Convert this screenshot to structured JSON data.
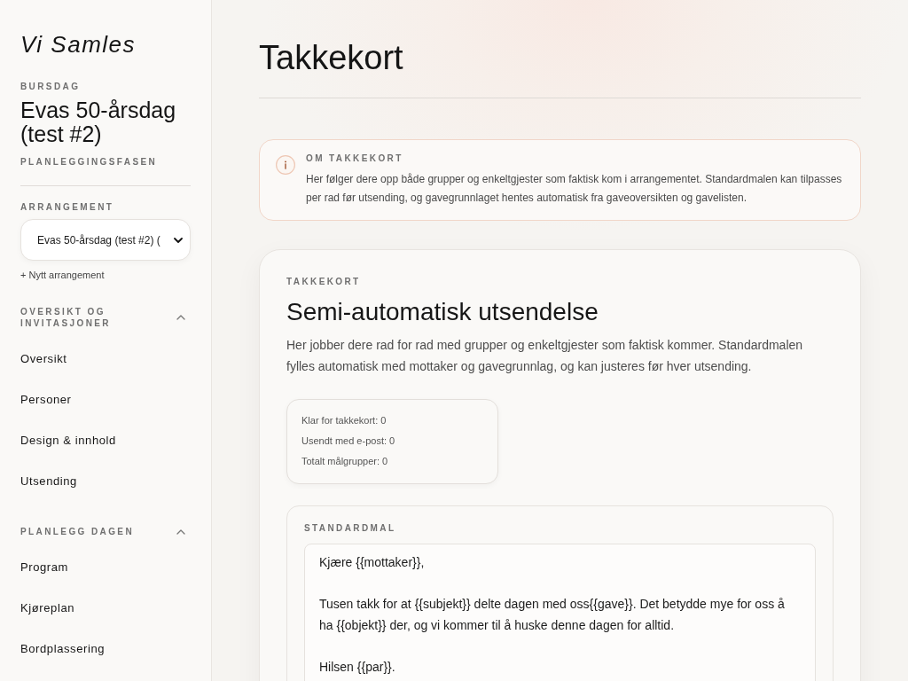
{
  "sidebar": {
    "logo": "Vi Samles",
    "event_type": "BURSDAG",
    "event_name": "Evas 50-årsdag (test #2)",
    "phase": "PLANLEGGINGSFASEN",
    "event_picker": {
      "label": "ARRANGEMENT",
      "value": "Evas 50-årsdag (test #2) ("
    },
    "new_event_link": "+ Nytt arrangement",
    "sections": [
      {
        "title": "OVERSIKT OG INVITASJONER",
        "expanded": true,
        "items": [
          {
            "label": "Oversikt",
            "selected": false
          },
          {
            "label": "Personer",
            "selected": false
          },
          {
            "label": "Design & innhold",
            "selected": false
          },
          {
            "label": "Utsending",
            "selected": false
          }
        ]
      },
      {
        "title": "PLANLEGG DAGEN",
        "expanded": true,
        "items": [
          {
            "label": "Program",
            "selected": false
          },
          {
            "label": "Kjøreplan",
            "selected": false
          },
          {
            "label": "Bordplassering",
            "selected": false
          }
        ]
      }
    ]
  },
  "page": {
    "title": "Takkekort"
  },
  "info_box": {
    "title": "OM TAKKEKORT",
    "text": "Her følger dere opp både grupper og enkeltgjester som faktisk kom i arrangementet. Standardmalen kan tilpasses per rad før utsending, og gavegrunnlaget hentes automatisk fra gaveoversikten og gavelisten."
  },
  "card": {
    "eyebrow": "TAKKEKORT",
    "title": "Semi-automatisk utsendelse",
    "description": "Her jobber dere rad for rad med grupper og enkeltgjester som faktisk kommer. Standardmalen fylles automatisk med mottaker og gavegrunnlag, og kan justeres før hver utsending.",
    "stats": [
      "Klar for takkekort: 0",
      "Usendt med e-post: 0",
      "Totalt målgrupper: 0"
    ],
    "template": {
      "label": "STANDARDMAL",
      "value": "Kjære {{mottaker}},\n\nTusen takk for at {{subjekt}} delte dagen med oss{{gave}}. Det betydde mye for oss å ha {{objekt}} der, og vi kommer til å huske denne dagen for alltid.\n\nHilsen {{par}}."
    }
  }
}
